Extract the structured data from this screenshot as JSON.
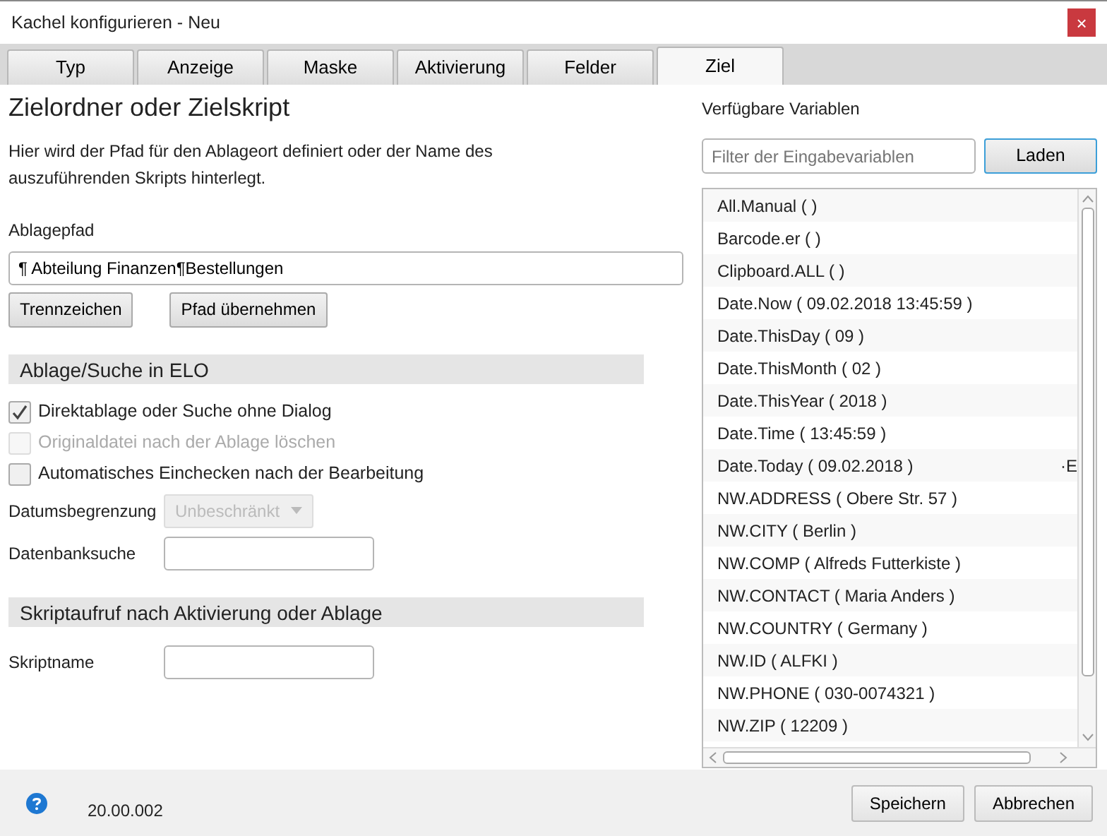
{
  "window": {
    "title": "Kachel konfigurieren - Neu",
    "close": "×"
  },
  "tabs": [
    {
      "label": "Typ",
      "selected": false
    },
    {
      "label": "Anzeige",
      "selected": false
    },
    {
      "label": "Maske",
      "selected": false
    },
    {
      "label": "Aktivierung",
      "selected": false
    },
    {
      "label": "Felder",
      "selected": false
    },
    {
      "label": "Ziel",
      "selected": true
    }
  ],
  "heading": "Zielordner oder Zielskript",
  "description": "Hier wird der Pfad für den Ablageort definiert oder der Name des auszuführenden Skripts hinterlegt.",
  "path": {
    "label": "Ablagepfad",
    "value": "¶ Abteilung Finanzen¶Bestellungen",
    "buttons": [
      "Trennzeichen",
      "Pfad übernehmen"
    ]
  },
  "storage": {
    "title": "Ablage/Suche in ELO",
    "checkboxes": [
      {
        "label": "Direktablage oder Suche ohne Dialog",
        "checked": true,
        "disabled": false
      },
      {
        "label": "Originaldatei nach der Ablage löschen",
        "checked": false,
        "disabled": true
      },
      {
        "label": "Automatisches Einchecken nach der Bearbeitung",
        "checked": false,
        "disabled": false
      }
    ],
    "date_limit": {
      "label": "Datumsbegrenzung",
      "value": "Unbeschränkt",
      "disabled": true
    },
    "db_search": {
      "label": "Datenbanksuche"
    }
  },
  "script": {
    "title": "Skriptaufruf nach Aktivierung oder Ablage",
    "field_label": "Skriptname"
  },
  "variables": {
    "title": "Verfügbare Variablen",
    "filter_placeholder": "Filter der Eingabevariablen",
    "load_button": "Laden",
    "items": [
      {
        "text": "All.Manual (  )"
      },
      {
        "text": "Barcode.er (  )"
      },
      {
        "text": "Clipboard.ALL (  )"
      },
      {
        "text": "Date.Now ( 09.02.2018 13:45:59 )"
      },
      {
        "text": "Date.ThisDay ( 09 )"
      },
      {
        "text": "Date.ThisMonth ( 02 )"
      },
      {
        "text": "Date.ThisYear ( 2018 )"
      },
      {
        "text": "Date.Time ( 13:45:59 )"
      },
      {
        "text": "Date.Today ( 09.02.2018 )",
        "trailing": "·E"
      },
      {
        "text": "NW.ADDRESS ( Obere Str. 57 )"
      },
      {
        "text": "NW.CITY ( Berlin )"
      },
      {
        "text": "NW.COMP ( Alfreds Futterkiste )"
      },
      {
        "text": "NW.CONTACT ( Maria Anders )"
      },
      {
        "text": "NW.COUNTRY ( Germany )"
      },
      {
        "text": "NW.ID ( ALFKI )"
      },
      {
        "text": "NW.PHONE ( 030-0074321 )"
      },
      {
        "text": "NW.ZIP ( 12209 )"
      }
    ]
  },
  "footer": {
    "version": "20.00.002",
    "buttons": [
      "Speichern",
      "Abbrechen"
    ]
  }
}
